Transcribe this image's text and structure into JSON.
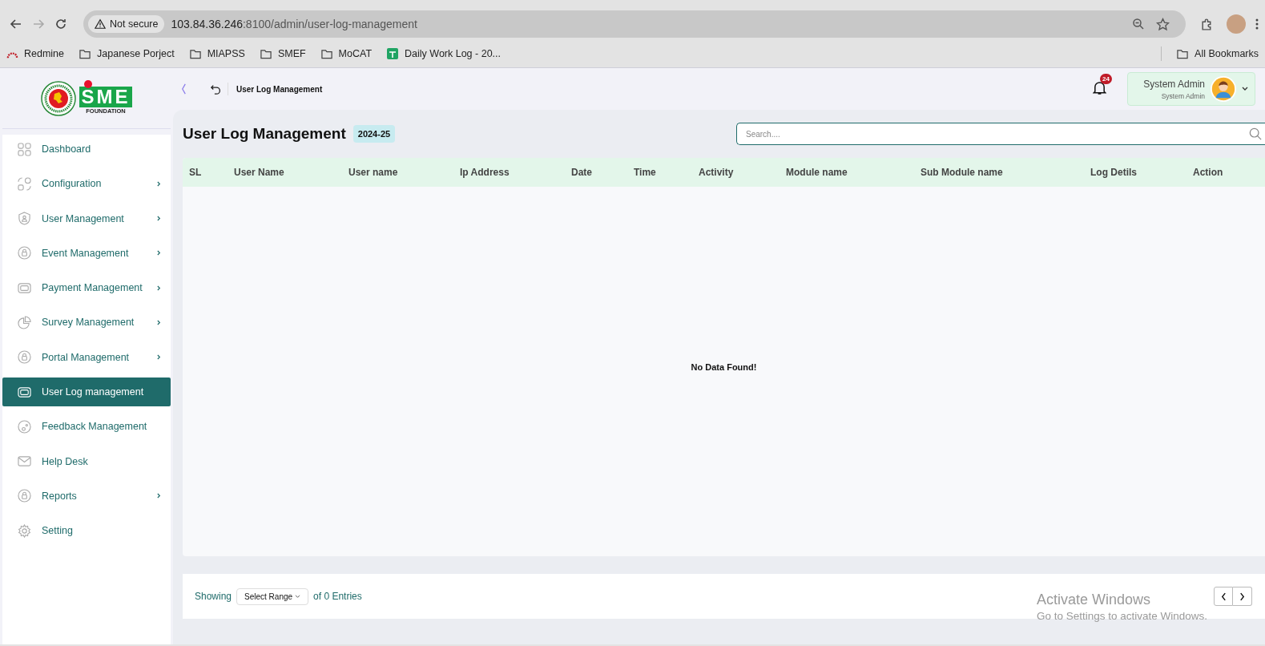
{
  "browser": {
    "security_label": "Not secure",
    "url_host": "103.84.36.246",
    "url_path": ":8100/admin/user-log-management",
    "bookmarks": [
      {
        "kind": "site",
        "label": "Redmine"
      },
      {
        "kind": "folder",
        "label": "Japanese Porject"
      },
      {
        "kind": "folder",
        "label": "MIAPSS"
      },
      {
        "kind": "folder",
        "label": "SMEF"
      },
      {
        "kind": "folder",
        "label": "MoCAT"
      },
      {
        "kind": "sheet",
        "label": "Daily Work Log - 20..."
      }
    ],
    "all_bookmarks": "All Bookmarks"
  },
  "logo": {
    "brand": "SME",
    "subtitle": "FOUNDATION"
  },
  "sidebar": {
    "items": [
      {
        "label": "Dashboard",
        "has_submenu": false,
        "selected": false
      },
      {
        "label": "Configuration",
        "has_submenu": true,
        "selected": false
      },
      {
        "label": "User Management",
        "has_submenu": true,
        "selected": false
      },
      {
        "label": "Event Management",
        "has_submenu": true,
        "selected": false
      },
      {
        "label": "Payment Management",
        "has_submenu": true,
        "selected": false
      },
      {
        "label": "Survey Management",
        "has_submenu": true,
        "selected": false
      },
      {
        "label": "Portal Management",
        "has_submenu": true,
        "selected": false
      },
      {
        "label": "User Log management",
        "has_submenu": false,
        "selected": true
      },
      {
        "label": "Feedback Management",
        "has_submenu": false,
        "selected": false
      },
      {
        "label": "Help Desk",
        "has_submenu": false,
        "selected": false
      },
      {
        "label": "Reports",
        "has_submenu": true,
        "selected": false
      },
      {
        "label": "Setting",
        "has_submenu": false,
        "selected": false
      }
    ]
  },
  "header": {
    "breadcrumb": "User Log Management",
    "notification_count": "24",
    "user_name": "System Admin",
    "user_role": "System Admin"
  },
  "page": {
    "title": "User Log Management",
    "fiscal_year": "2024-25",
    "search": {
      "placeholder": "Search...."
    }
  },
  "table": {
    "columns": [
      "SL",
      "User Name",
      "User name",
      "Ip Address",
      "Date",
      "Time",
      "Activity",
      "Module name",
      "Sub Module name",
      "Log Detils",
      "Action"
    ],
    "empty_message": "No Data Found!"
  },
  "footer": {
    "showing_label": "Showing",
    "range_select": "Select Range",
    "entries_label": "of 0 Entries"
  },
  "windows_activation": {
    "title": "Activate Windows",
    "hint": "Go to Settings to activate Windows."
  }
}
